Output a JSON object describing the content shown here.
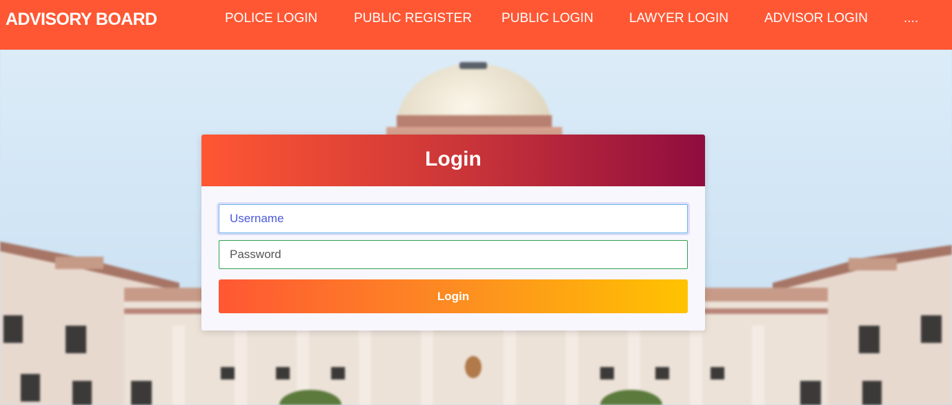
{
  "navbar": {
    "brand": "ADVISORY BOARD",
    "links": [
      {
        "label": "POLICE LOGIN"
      },
      {
        "label": "PUBLIC REGISTER"
      },
      {
        "label": "PUBLIC LOGIN"
      },
      {
        "label": "LAWYER LOGIN"
      },
      {
        "label": "ADVISOR LOGIN"
      },
      {
        "label": "...."
      }
    ]
  },
  "login_form": {
    "title": "Login",
    "username": {
      "placeholder": "Username",
      "value": ""
    },
    "password": {
      "placeholder": "Password",
      "value": ""
    },
    "submit_label": "Login"
  },
  "colors": {
    "navbar": "#ff5733",
    "header_gradient": [
      "#ff5733",
      "#900c3f"
    ],
    "button_gradient": [
      "#ff5733",
      "#ffc300"
    ]
  }
}
